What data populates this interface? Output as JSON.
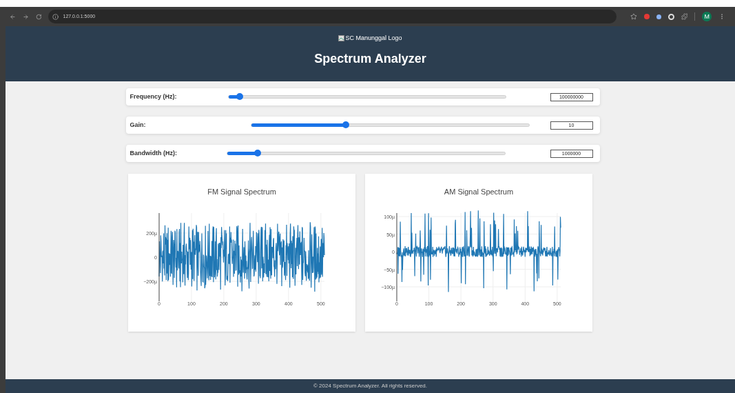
{
  "browser": {
    "url": "127.0.0.1:5000",
    "profile_initial": "M"
  },
  "header": {
    "logo_alt": "SC Manunggal Logo",
    "title": "Spectrum Analyzer"
  },
  "controls": [
    {
      "label": "Frequency (Hz):",
      "level": 0.04,
      "value": "100000000"
    },
    {
      "label": "Gain:",
      "level": 0.34,
      "value": "10"
    },
    {
      "label": "Bandwidth (Hz):",
      "level": 0.11,
      "value": "1000000"
    }
  ],
  "charts": [
    {
      "kind": "fm",
      "title": "FM Signal Spectrum",
      "x_ticks": [
        "0",
        "100",
        "200",
        "300",
        "400",
        "500"
      ],
      "y_ticks": [
        "200µ",
        "0",
        "−200µ"
      ]
    },
    {
      "kind": "am",
      "title": "AM Signal Spectrum",
      "x_ticks": [
        "0",
        "100",
        "200",
        "300",
        "400",
        "500"
      ],
      "y_ticks": [
        "100µ",
        "50µ",
        "0",
        "−50µ",
        "−100µ"
      ]
    }
  ],
  "footer": {
    "text": "© 2024 Spectrum Analyzer. All rights reserved."
  }
}
